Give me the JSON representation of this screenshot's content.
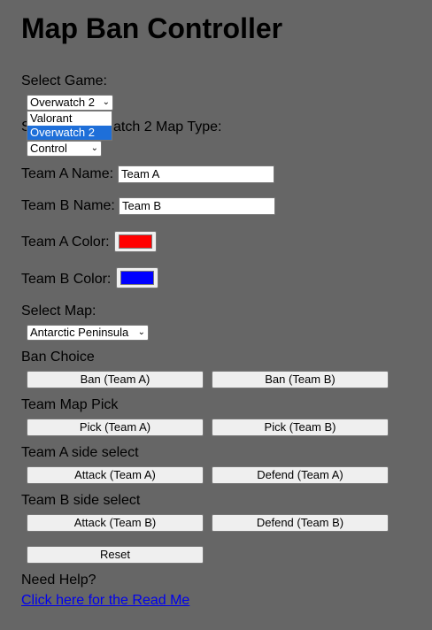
{
  "page": {
    "title": "Map Ban Controller"
  },
  "game_select": {
    "label": "Select Game:",
    "selected": "Overwatch 2",
    "options": [
      "Valorant",
      "Overwatch 2"
    ]
  },
  "map_type": {
    "label": "Select Overwatch 2 Map Type:",
    "label_visible_part": "S",
    "label_visible_tail": "atch 2 Map Type:",
    "selected": "Control"
  },
  "team_a": {
    "name_label": "Team A Name:",
    "name_value": "Team A",
    "color_label": "Team A Color:",
    "color": "#ff0000"
  },
  "team_b": {
    "name_label": "Team B Name:",
    "name_value": "Team B",
    "color_label": "Team B Color:",
    "color": "#0000ff"
  },
  "map_select": {
    "label": "Select Map:",
    "selected": "Antarctic Peninsula"
  },
  "ban": {
    "heading": "Ban Choice",
    "team_a_button": "Ban (Team A)",
    "team_b_button": "Ban (Team B)"
  },
  "pick": {
    "heading": "Team Map Pick",
    "team_a_button": "Pick (Team A)",
    "team_b_button": "Pick (Team B)"
  },
  "side_a": {
    "heading": "Team A side select",
    "attack_button": "Attack (Team A)",
    "defend_button": "Defend (Team A)"
  },
  "side_b": {
    "heading": "Team B side select",
    "attack_button": "Attack (Team B)",
    "defend_button": "Defend (Team B)"
  },
  "reset_button": "Reset",
  "help": {
    "label": "Need Help?",
    "link_text": "Click here for the Read Me"
  }
}
